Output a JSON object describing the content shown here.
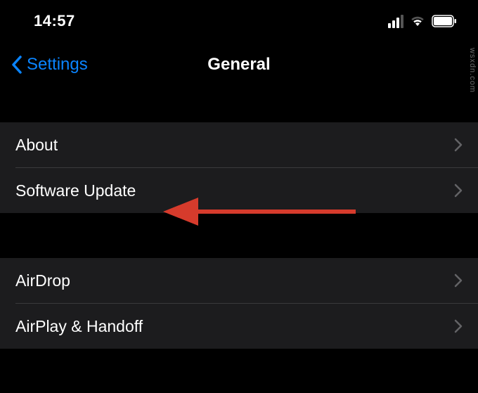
{
  "status": {
    "time": "14:57"
  },
  "nav": {
    "back_label": "Settings",
    "title": "General"
  },
  "group1": {
    "row0": {
      "label": "About"
    },
    "row1": {
      "label": "Software Update"
    }
  },
  "group2": {
    "row0": {
      "label": "AirDrop"
    },
    "row1": {
      "label": "AirPlay & Handoff"
    }
  },
  "watermark": "wsxdn.com",
  "colors": {
    "link": "#0a84ff",
    "annotation": "#d63b2c"
  }
}
